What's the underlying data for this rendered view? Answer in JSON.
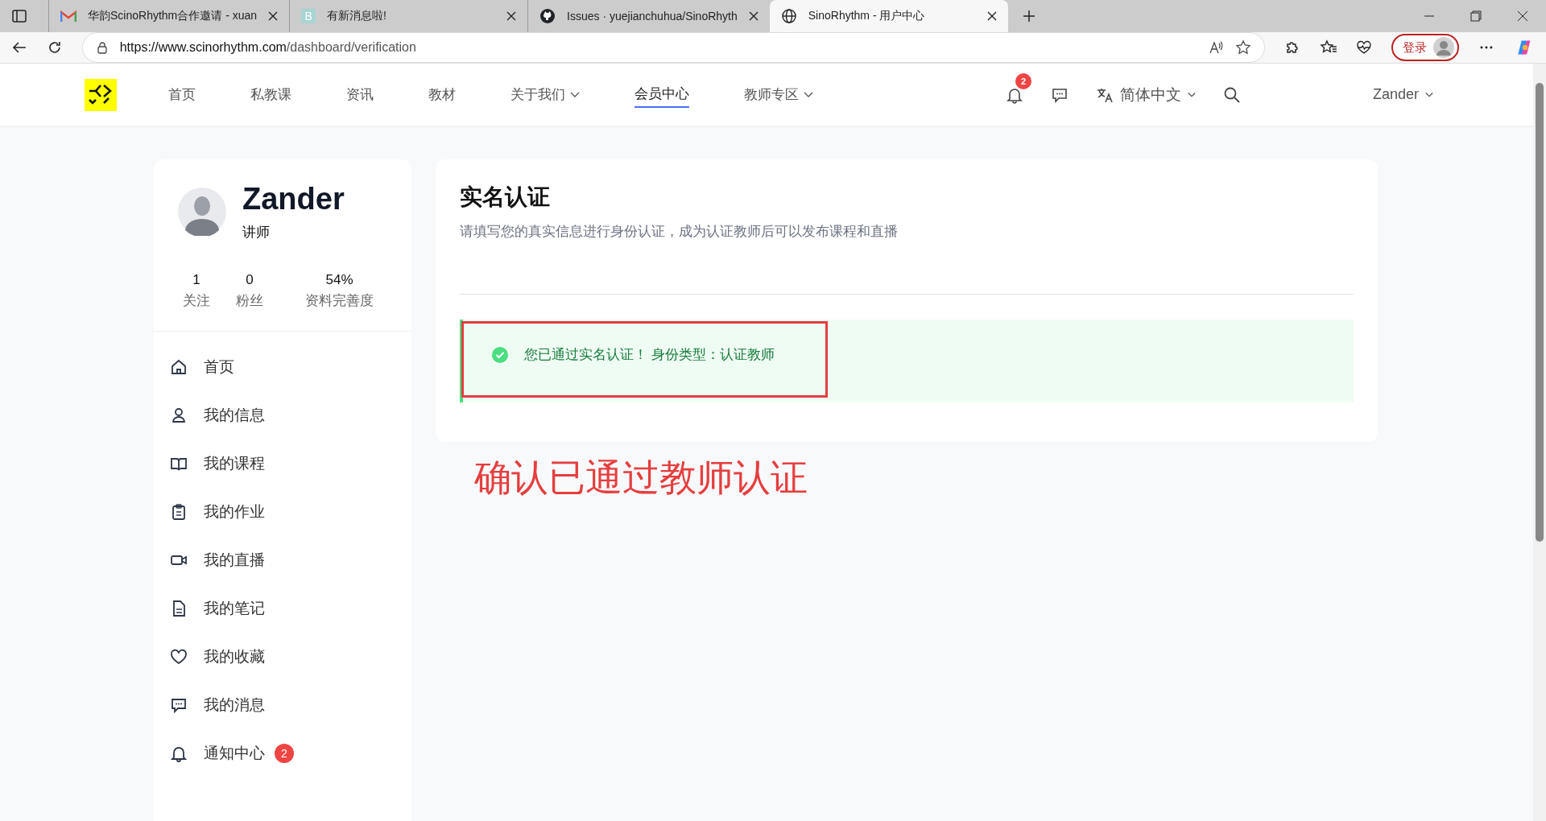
{
  "browser": {
    "tabs": [
      {
        "title": "华韵ScinoRhythm合作邀请 - xuan",
        "selected": false
      },
      {
        "title": "有新消息啦!",
        "selected": false
      },
      {
        "title": "Issues · yuejianchuhua/SinoRhyth",
        "selected": false
      },
      {
        "title": "SinoRhythm - 用户中心",
        "selected": true
      }
    ],
    "url_host": "https://www.scinorhythm.com",
    "url_path": "/dashboard/verification",
    "letter_icon_text": "B",
    "login_label": "登录"
  },
  "nav": {
    "items": [
      {
        "label": "首页",
        "dropdown": false,
        "selected": false
      },
      {
        "label": "私教课",
        "dropdown": false,
        "selected": false
      },
      {
        "label": "资讯",
        "dropdown": false,
        "selected": false
      },
      {
        "label": "教材",
        "dropdown": false,
        "selected": false
      },
      {
        "label": "关于我们",
        "dropdown": true,
        "selected": false
      },
      {
        "label": "会员中心",
        "dropdown": false,
        "selected": true
      },
      {
        "label": "教师专区",
        "dropdown": true,
        "selected": false
      }
    ],
    "notification_count": "2",
    "language": "简体中文",
    "user": "Zander"
  },
  "profile": {
    "name": "Zander",
    "role": "讲师",
    "stats": [
      {
        "value": "1",
        "label": "关注"
      },
      {
        "value": "0",
        "label": "粉丝"
      },
      {
        "value": "54%",
        "label": "资料完善度"
      }
    ]
  },
  "sidebar": {
    "items": [
      {
        "label": "首页"
      },
      {
        "label": "我的信息"
      },
      {
        "label": "我的课程"
      },
      {
        "label": "我的作业"
      },
      {
        "label": "我的直播"
      },
      {
        "label": "我的笔记"
      },
      {
        "label": "我的收藏"
      },
      {
        "label": "我的消息"
      },
      {
        "label": "通知中心",
        "badge": "2"
      }
    ]
  },
  "main": {
    "title": "实名认证",
    "subtitle": "请填写您的真实信息进行身份认证，成为认证教师后可以发布课程和直播",
    "alert": {
      "kind": "success",
      "message": "您已通过实名认证！ 身份类型：认证教师"
    },
    "annotation": "确认已通过教师认证"
  }
}
